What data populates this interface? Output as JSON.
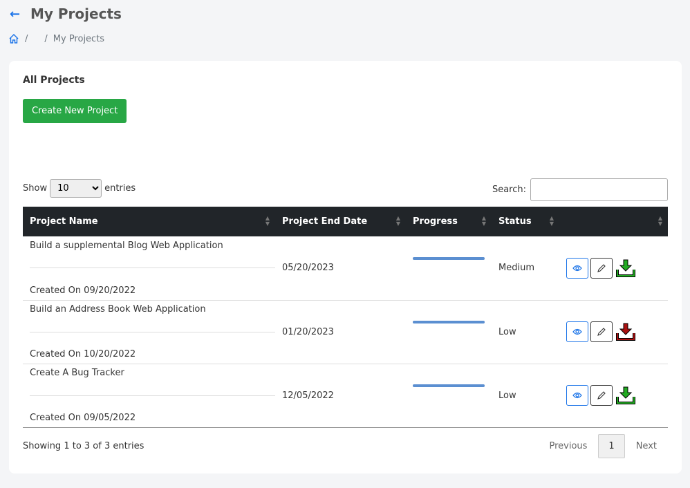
{
  "header": {
    "title": "My Projects",
    "back_icon": "arrow-left-icon"
  },
  "breadcrumb": {
    "sep1": "/",
    "sep2": "/",
    "current": "My Projects"
  },
  "card": {
    "title": "All Projects",
    "create_label": "Create New Project"
  },
  "length": {
    "show": "Show",
    "value": "10",
    "entries": "entries"
  },
  "search": {
    "label": "Search:",
    "value": ""
  },
  "columns": [
    "Project Name",
    "Project End Date",
    "Progress",
    "Status",
    ""
  ],
  "rows": [
    {
      "name": "Build a supplemental Blog Web Application",
      "created": "Created On 09/20/2022",
      "end": "05/20/2023",
      "progress": 100,
      "status": "Medium",
      "download_color": "#22aa22"
    },
    {
      "name": "Build an Address Book Web Application",
      "created": "Created On 10/20/2022",
      "end": "01/20/2023",
      "progress": 100,
      "status": "Low",
      "download_color": "#aa1111"
    },
    {
      "name": "Create A Bug Tracker",
      "created": "Created On 09/05/2022",
      "end": "12/05/2022",
      "progress": 100,
      "status": "Low",
      "download_color": "#22aa22"
    }
  ],
  "footer": {
    "info": "Showing 1 to 3 of 3 entries",
    "prev": "Previous",
    "page": "1",
    "next": "Next"
  }
}
